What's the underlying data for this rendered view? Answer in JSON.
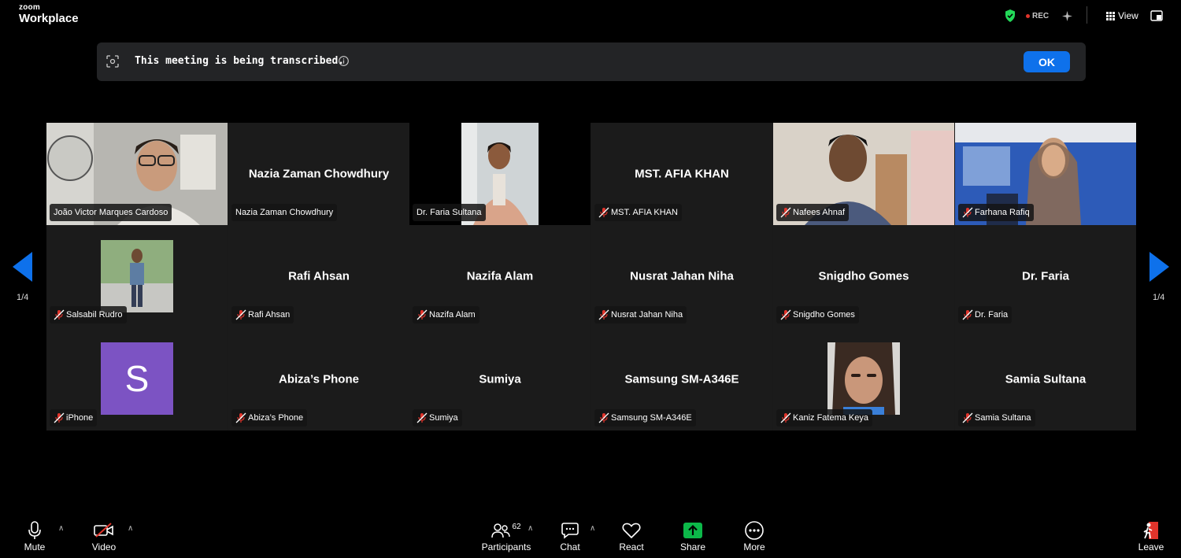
{
  "app": {
    "brand_small": "zoom",
    "brand_big": "Workplace"
  },
  "topbar": {
    "rec_label": "REC",
    "view_label": "View"
  },
  "banner": {
    "text": "This meeting is being transcribed.",
    "ok_label": "OK"
  },
  "pagination": {
    "left": "1/4",
    "right": "1/4"
  },
  "tiles": [
    {
      "label": "João Victor Marques Cardoso",
      "center": "",
      "muted": false,
      "active": true
    },
    {
      "label": "Nazia Zaman Chowdhury",
      "center": "Nazia Zaman Chowdhury",
      "muted": false
    },
    {
      "label": "Dr. Faria Sultana",
      "center": "",
      "muted": false
    },
    {
      "label": "MST. AFIA KHAN",
      "center": "MST. AFIA KHAN",
      "muted": true
    },
    {
      "label": "Nafees Ahnaf",
      "center": "",
      "muted": true
    },
    {
      "label": "Farhana Rafiq",
      "center": "",
      "muted": true
    },
    {
      "label": "Salsabil Rudro",
      "center": "",
      "muted": true
    },
    {
      "label": "Rafi Ahsan",
      "center": "Rafi Ahsan",
      "muted": true
    },
    {
      "label": "Nazifa Alam",
      "center": "Nazifa Alam",
      "muted": true
    },
    {
      "label": "Nusrat Jahan Niha",
      "center": "Nusrat Jahan Niha",
      "muted": true
    },
    {
      "label": "Snigdho Gomes",
      "center": "Snigdho Gomes",
      "muted": true
    },
    {
      "label": "Dr. Faria",
      "center": "Dr. Faria",
      "muted": true
    },
    {
      "label": "iPhone",
      "center": "",
      "muted": true,
      "avatar_letter": "S"
    },
    {
      "label": "Abiza’s Phone",
      "center": "Abiza’s Phone",
      "muted": true
    },
    {
      "label": "Sumiya",
      "center": "Sumiya",
      "muted": true
    },
    {
      "label": "Samsung SM-A346E",
      "center": "Samsung SM-A346E",
      "muted": true
    },
    {
      "label": "Kaniz Fatema Keya",
      "center": "",
      "muted": true
    },
    {
      "label": "Samia Sultana",
      "center": "Samia Sultana",
      "muted": true
    }
  ],
  "toolbar": {
    "mute": "Mute",
    "video": "Video",
    "participants": "Participants",
    "participants_count": "62",
    "chat": "Chat",
    "react": "React",
    "share": "Share",
    "more": "More",
    "leave": "Leave"
  },
  "colors": {
    "accent": "#0e71eb",
    "active_border": "#23d959",
    "share_green": "#0cb849",
    "mute_red": "#e0342b"
  }
}
